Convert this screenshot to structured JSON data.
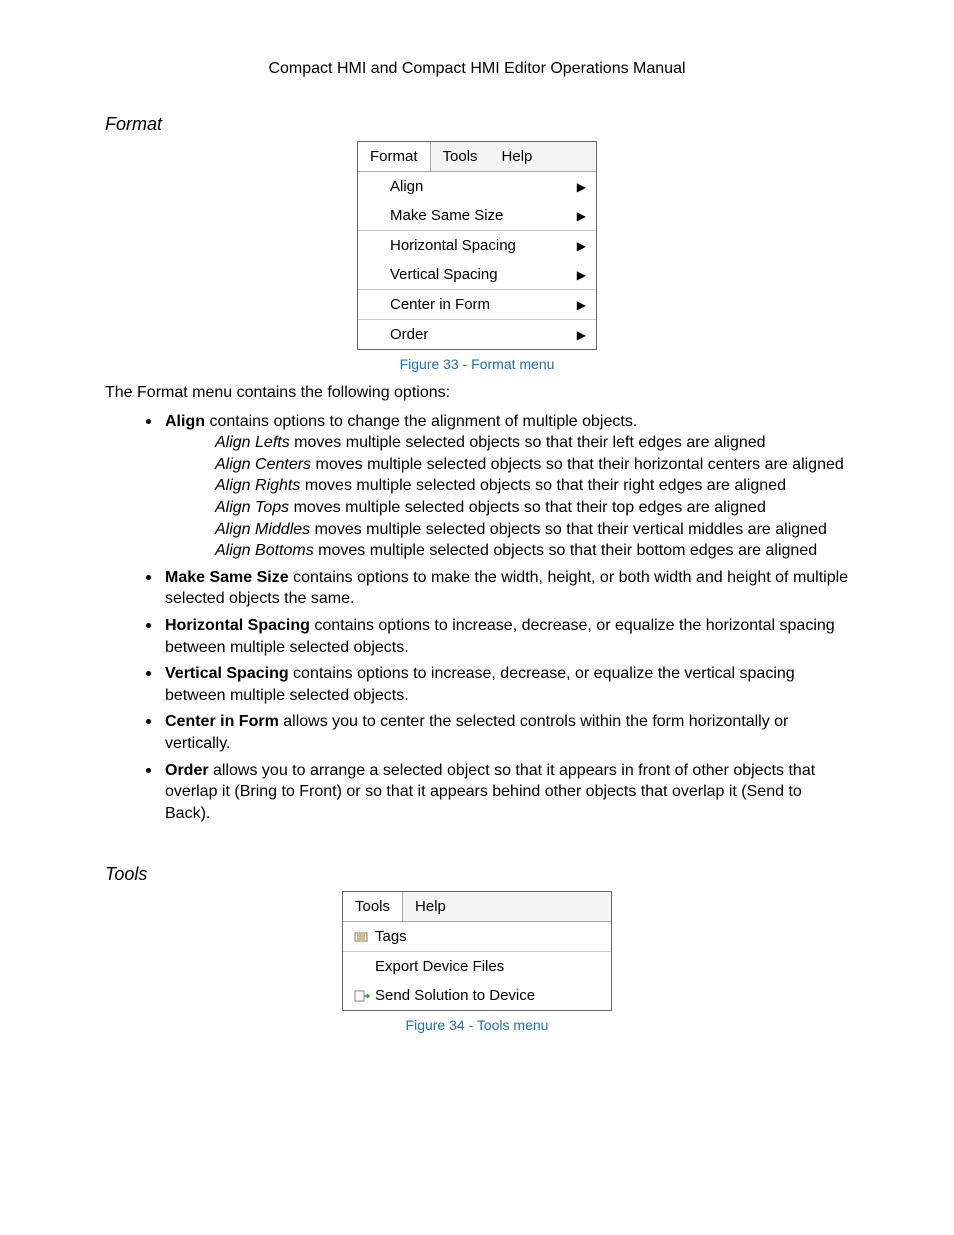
{
  "header": "Compact HMI and Compact HMI Editor Operations Manual",
  "format": {
    "section_title": "Format",
    "menubar": {
      "format": "Format",
      "tools": "Tools",
      "help": "Help"
    },
    "items": [
      "Align",
      "Make Same Size",
      "Horizontal Spacing",
      "Vertical Spacing",
      "Center in Form",
      "Order"
    ],
    "caption": "Figure 33 - Format menu",
    "intro": "The Format menu contains the following options:",
    "align": {
      "label": "Align",
      "desc": " contains options to change the alignment of multiple objects.",
      "sub": [
        {
          "em": "Align Lefts",
          "rest": " moves multiple selected objects so that their left edges are aligned"
        },
        {
          "em": "Align Centers",
          "rest": " moves multiple selected objects so that their horizontal centers are aligned"
        },
        {
          "em": "Align Rights",
          "rest": " moves multiple selected objects so that their right edges are aligned"
        },
        {
          "em": "Align Tops",
          "rest": " moves multiple selected objects so that their top edges are aligned"
        },
        {
          "em": "Align Middles",
          "rest": " moves multiple selected objects so that their vertical middles are aligned"
        },
        {
          "em": "Align Bottoms",
          "rest": " moves multiple selected objects so that their bottom edges are aligned"
        }
      ]
    },
    "b2": {
      "label": "Make Same Size",
      "desc": " contains options to make the width, height, or both width and height of multiple selected objects the same."
    },
    "b3": {
      "label": "Horizontal Spacing",
      "desc": " contains options to increase, decrease, or equalize the horizontal spacing between multiple selected objects."
    },
    "b4": {
      "label": "Vertical Spacing",
      "desc": " contains options to increase, decrease, or equalize the vertical spacing between multiple selected objects."
    },
    "b5": {
      "label": "Center in Form",
      "desc": " allows you to center the selected controls within the form horizontally or vertically."
    },
    "b6": {
      "label": "Order",
      "desc": " allows you to arrange a selected object so that it appears in front of other objects that overlap it (Bring to Front) or so that it appears behind other objects that overlap it (Send to Back)."
    }
  },
  "tools": {
    "section_title": "Tools",
    "menubar": {
      "tools": "Tools",
      "help": "Help"
    },
    "items": [
      "Tags",
      "Export Device Files",
      "Send Solution to Device"
    ],
    "caption": "Figure 34 - Tools menu"
  }
}
